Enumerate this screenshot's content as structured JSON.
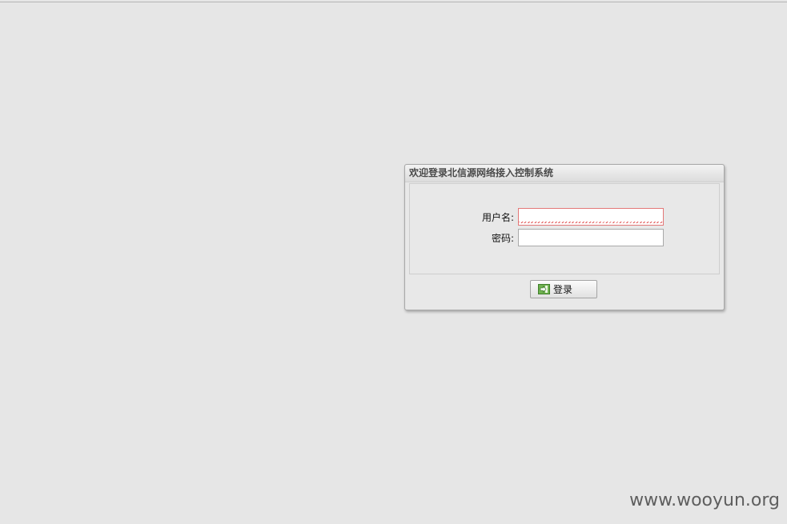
{
  "login_dialog": {
    "title": "欢迎登录北信源网络接入控制系统",
    "username": {
      "label": "用户名:",
      "value": "",
      "placeholder": ""
    },
    "password": {
      "label": "密码:",
      "value": "",
      "placeholder": ""
    },
    "submit_label": "登录",
    "submit_icon": "login-arrow-icon"
  },
  "watermark": "www.wooyun.org",
  "colors": {
    "page_background": "#e6e6e6",
    "invalid_field_border": "#e37878",
    "login_icon_green": "#4d9a36"
  }
}
